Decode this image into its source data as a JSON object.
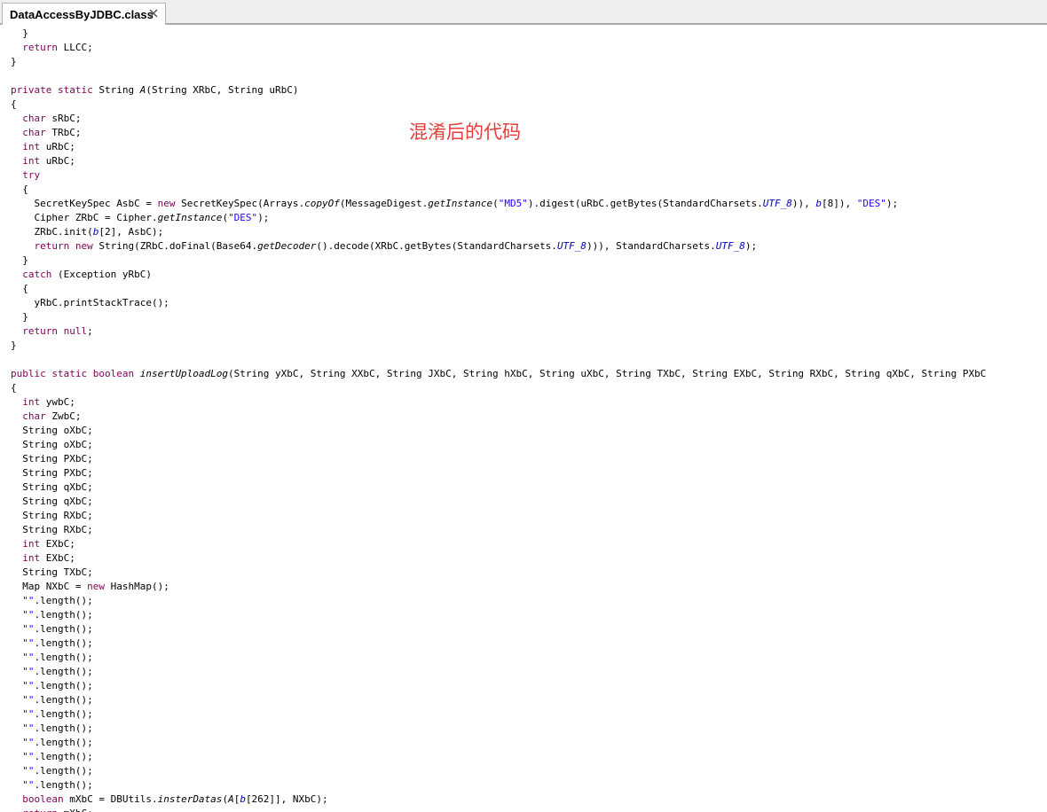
{
  "tab": {
    "title": "DataAccessByJDBC.class",
    "close_icon": "close-icon"
  },
  "annotation": {
    "text": "混淆后的代码",
    "color": "#e83c3c"
  },
  "colors": {
    "keyword": "#7f0055",
    "string": "#2a00ff",
    "field": "#0000c0"
  },
  "code": [
    [
      {
        "t": "  }"
      }
    ],
    [
      {
        "t": "  "
      },
      {
        "t": "return",
        "c": "kw"
      },
      {
        "t": " LLCC;"
      }
    ],
    [
      {
        "t": "}"
      }
    ],
    [],
    [
      {
        "t": "private static",
        "c": "kw"
      },
      {
        "t": " String "
      },
      {
        "t": "A",
        "c": "st"
      },
      {
        "t": "(String XRbC, String uRbC)"
      }
    ],
    [
      {
        "t": "{"
      }
    ],
    [
      {
        "t": "  "
      },
      {
        "t": "char",
        "c": "kw"
      },
      {
        "t": " sRbC;"
      }
    ],
    [
      {
        "t": "  "
      },
      {
        "t": "char",
        "c": "kw"
      },
      {
        "t": " TRbC;"
      }
    ],
    [
      {
        "t": "  "
      },
      {
        "t": "int",
        "c": "kw"
      },
      {
        "t": " uRbC;"
      }
    ],
    [
      {
        "t": "  "
      },
      {
        "t": "int",
        "c": "kw"
      },
      {
        "t": " uRbC;"
      }
    ],
    [
      {
        "t": "  "
      },
      {
        "t": "try",
        "c": "kw"
      }
    ],
    [
      {
        "t": "  {"
      }
    ],
    [
      {
        "t": "    SecretKeySpec AsbC = "
      },
      {
        "t": "new",
        "c": "kw"
      },
      {
        "t": " SecretKeySpec(Arrays."
      },
      {
        "t": "copyOf",
        "c": "st"
      },
      {
        "t": "(MessageDigest."
      },
      {
        "t": "getInstance",
        "c": "st"
      },
      {
        "t": "("
      },
      {
        "t": "\"MD5\"",
        "c": "str"
      },
      {
        "t": ").digest(uRbC.getBytes(StandardCharsets."
      },
      {
        "t": "UTF_8",
        "c": "fld"
      },
      {
        "t": ")), "
      },
      {
        "t": "b",
        "c": "fld"
      },
      {
        "t": "[8]), "
      },
      {
        "t": "\"DES\"",
        "c": "str"
      },
      {
        "t": ");"
      }
    ],
    [
      {
        "t": "    Cipher ZRbC = Cipher."
      },
      {
        "t": "getInstance",
        "c": "st"
      },
      {
        "t": "("
      },
      {
        "t": "\"DES\"",
        "c": "str"
      },
      {
        "t": ");"
      }
    ],
    [
      {
        "t": "    ZRbC.init("
      },
      {
        "t": "b",
        "c": "fld"
      },
      {
        "t": "[2], AsbC);"
      }
    ],
    [
      {
        "t": "    "
      },
      {
        "t": "return new",
        "c": "kw"
      },
      {
        "t": " String(ZRbC.doFinal(Base64."
      },
      {
        "t": "getDecoder",
        "c": "st"
      },
      {
        "t": "().decode(XRbC.getBytes(StandardCharsets."
      },
      {
        "t": "UTF_8",
        "c": "fld"
      },
      {
        "t": "))), StandardCharsets."
      },
      {
        "t": "UTF_8",
        "c": "fld"
      },
      {
        "t": ");"
      }
    ],
    [
      {
        "t": "  }"
      }
    ],
    [
      {
        "t": "  "
      },
      {
        "t": "catch",
        "c": "kw"
      },
      {
        "t": " (Exception yRbC)"
      }
    ],
    [
      {
        "t": "  {"
      }
    ],
    [
      {
        "t": "    yRbC.printStackTrace();"
      }
    ],
    [
      {
        "t": "  }"
      }
    ],
    [
      {
        "t": "  "
      },
      {
        "t": "return null",
        "c": "kw"
      },
      {
        "t": ";"
      }
    ],
    [
      {
        "t": "}"
      }
    ],
    [],
    [
      {
        "t": "public static boolean",
        "c": "kw"
      },
      {
        "t": " "
      },
      {
        "t": "insertUploadLog",
        "c": "st"
      },
      {
        "t": "(String yXbC, String XXbC, String JXbC, String hXbC, String uXbC, String TXbC, String EXbC, String RXbC, String qXbC, String PXbC"
      }
    ],
    [
      {
        "t": "{"
      }
    ],
    [
      {
        "t": "  "
      },
      {
        "t": "int",
        "c": "kw"
      },
      {
        "t": " ywbC;"
      }
    ],
    [
      {
        "t": "  "
      },
      {
        "t": "char",
        "c": "kw"
      },
      {
        "t": " ZwbC;"
      }
    ],
    [
      {
        "t": "  String oXbC;"
      }
    ],
    [
      {
        "t": "  String oXbC;"
      }
    ],
    [
      {
        "t": "  String PXbC;"
      }
    ],
    [
      {
        "t": "  String PXbC;"
      }
    ],
    [
      {
        "t": "  String qXbC;"
      }
    ],
    [
      {
        "t": "  String qXbC;"
      }
    ],
    [
      {
        "t": "  String RXbC;"
      }
    ],
    [
      {
        "t": "  String RXbC;"
      }
    ],
    [
      {
        "t": "  "
      },
      {
        "t": "int",
        "c": "kw"
      },
      {
        "t": " EXbC;"
      }
    ],
    [
      {
        "t": "  "
      },
      {
        "t": "int",
        "c": "kw"
      },
      {
        "t": " EXbC;"
      }
    ],
    [
      {
        "t": "  String TXbC;"
      }
    ],
    [
      {
        "t": "  Map NXbC = "
      },
      {
        "t": "new",
        "c": "kw"
      },
      {
        "t": " HashMap();"
      }
    ],
    [
      {
        "t": "  "
      },
      {
        "t": "\"\"",
        "c": "str"
      },
      {
        "t": ".length();"
      }
    ],
    [
      {
        "t": "  "
      },
      {
        "t": "\"\"",
        "c": "str"
      },
      {
        "t": ".length();"
      }
    ],
    [
      {
        "t": "  "
      },
      {
        "t": "\"\"",
        "c": "str"
      },
      {
        "t": ".length();"
      }
    ],
    [
      {
        "t": "  "
      },
      {
        "t": "\"\"",
        "c": "str"
      },
      {
        "t": ".length();"
      }
    ],
    [
      {
        "t": "  "
      },
      {
        "t": "\"\"",
        "c": "str"
      },
      {
        "t": ".length();"
      }
    ],
    [
      {
        "t": "  "
      },
      {
        "t": "\"\"",
        "c": "str"
      },
      {
        "t": ".length();"
      }
    ],
    [
      {
        "t": "  "
      },
      {
        "t": "\"\"",
        "c": "str"
      },
      {
        "t": ".length();"
      }
    ],
    [
      {
        "t": "  "
      },
      {
        "t": "\"\"",
        "c": "str"
      },
      {
        "t": ".length();"
      }
    ],
    [
      {
        "t": "  "
      },
      {
        "t": "\"\"",
        "c": "str"
      },
      {
        "t": ".length();"
      }
    ],
    [
      {
        "t": "  "
      },
      {
        "t": "\"\"",
        "c": "str"
      },
      {
        "t": ".length();"
      }
    ],
    [
      {
        "t": "  "
      },
      {
        "t": "\"\"",
        "c": "str"
      },
      {
        "t": ".length();"
      }
    ],
    [
      {
        "t": "  "
      },
      {
        "t": "\"\"",
        "c": "str"
      },
      {
        "t": ".length();"
      }
    ],
    [
      {
        "t": "  "
      },
      {
        "t": "\"\"",
        "c": "str"
      },
      {
        "t": ".length();"
      }
    ],
    [
      {
        "t": "  "
      },
      {
        "t": "\"\"",
        "c": "str"
      },
      {
        "t": ".length();"
      }
    ],
    [
      {
        "t": "  "
      },
      {
        "t": "boolean",
        "c": "kw"
      },
      {
        "t": " mXbC = DBUtils."
      },
      {
        "t": "insterDatas",
        "c": "st"
      },
      {
        "t": "("
      },
      {
        "t": "A",
        "c": "st"
      },
      {
        "t": "["
      },
      {
        "t": "b",
        "c": "fld"
      },
      {
        "t": "[262]], NXbC);"
      }
    ],
    [
      {
        "t": "  "
      },
      {
        "t": "return",
        "c": "kw"
      },
      {
        "t": " mXbC;"
      }
    ]
  ]
}
